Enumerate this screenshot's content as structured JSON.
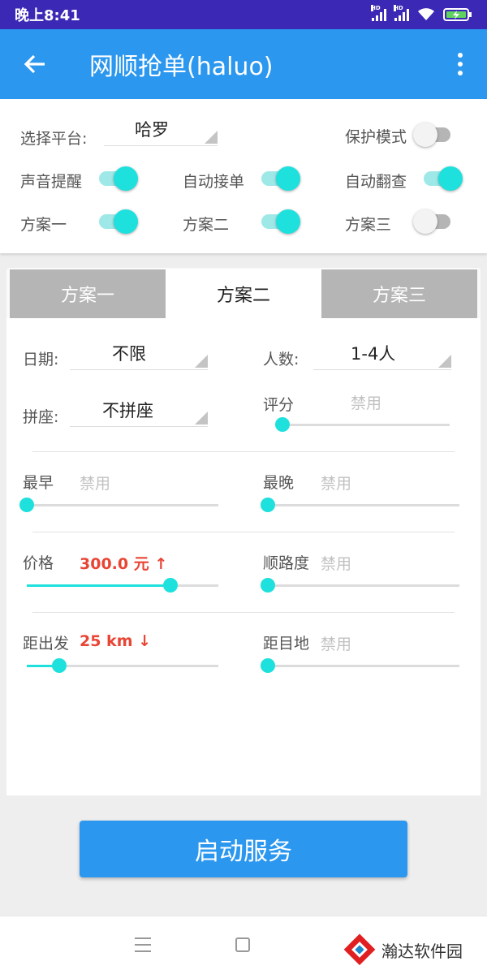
{
  "status_bar": {
    "time": "晚上8:41",
    "net1": "HD",
    "net2": "HD"
  },
  "app_bar": {
    "title": "网顺抢单(haluo)"
  },
  "settings": {
    "platform_label": "选择平台:",
    "platform_value": "哈罗",
    "protect_label": "保护模式",
    "protect_on": false,
    "sound_label": "声音提醒",
    "sound_on": true,
    "auto_accept_label": "自动接单",
    "auto_accept_on": true,
    "auto_check_label": "自动翻查",
    "auto_check_on": true,
    "plan1_label": "方案一",
    "plan1_on": true,
    "plan2_label": "方案二",
    "plan2_on": true,
    "plan3_label": "方案三",
    "plan3_on": false
  },
  "tabs": [
    {
      "label": "方案一",
      "active": false
    },
    {
      "label": "方案二",
      "active": true
    },
    {
      "label": "方案三",
      "active": false
    }
  ],
  "form": {
    "date_label": "日期:",
    "date_value": "不限",
    "people_label": "人数:",
    "people_value": "1-4人",
    "carpool_label": "拼座:",
    "carpool_value": "不拼座",
    "rating_label": "评分",
    "rating_value": "禁用",
    "rating_level": 0,
    "earliest_label": "最早",
    "earliest_value": "禁用",
    "earliest_level": 0,
    "latest_label": "最晚",
    "latest_value": "禁用",
    "latest_level": 0,
    "price_label": "价格",
    "price_value": "300.0 元",
    "price_arrow": "↑",
    "price_level": 0.75,
    "route_label": "顺路度",
    "route_value": "禁用",
    "route_level": 0,
    "distance_label": "距出发",
    "distance_value": "25 km",
    "distance_arrow": "↓",
    "distance_level": 0.17,
    "dest_label": "距目地",
    "dest_value": "禁用",
    "dest_level": 0
  },
  "start_button": {
    "label": "启动服务"
  },
  "nav_bar": {
    "icons": [
      "menu-icon",
      "home-icon"
    ]
  },
  "watermark": {
    "text": "瀚达软件园"
  },
  "colors": {
    "accent": "#2b97ef",
    "switch_on": "#1ee0dd",
    "status_bar": "#3b28b5",
    "highlight_red": "#e84534"
  }
}
